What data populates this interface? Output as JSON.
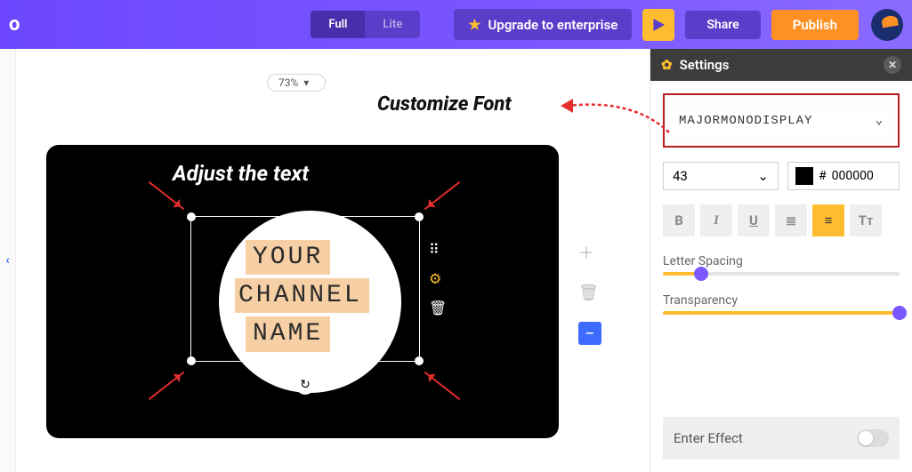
{
  "header": {
    "logo": "o",
    "mode_full": "Full",
    "mode_lite": "Lite",
    "upgrade": "Upgrade to enterprise",
    "share": "Share",
    "publish": "Publish"
  },
  "canvas": {
    "zoom": "73%",
    "adjust_label": "Adjust the text",
    "text_line1": "YOUR",
    "text_line2": "CHANNEL",
    "text_line3": "NAME"
  },
  "annotation": {
    "label": "Customize Font"
  },
  "settings": {
    "title": "Settings",
    "font_name": "MAJORMONODISPLAY",
    "font_size": "43",
    "color_hash": "#",
    "color_hex": "000000",
    "letter_spacing_label": "Letter Spacing",
    "transparency_label": "Transparency",
    "enter_effect_label": "Enter Effect",
    "letter_spacing_pct": 16,
    "transparency_pct": 100
  }
}
